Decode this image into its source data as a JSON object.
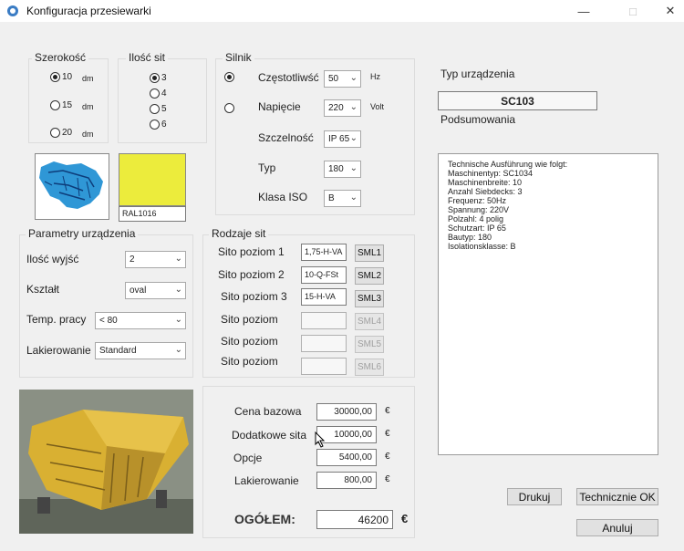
{
  "window": {
    "title": "Konfiguracja przesiewarki",
    "minimize_icon": "minimize-icon",
    "maximize_icon": "maximize-icon",
    "close_icon": "close-icon"
  },
  "szerokosc": {
    "label": "Szerokość",
    "options": [
      {
        "value": "10",
        "unit": "dm",
        "checked": true
      },
      {
        "value": "15",
        "unit": "dm",
        "checked": false
      },
      {
        "value": "20",
        "unit": "dm",
        "checked": false
      }
    ]
  },
  "ilosc_sit": {
    "label": "Ilość sit",
    "options": [
      {
        "value": "3",
        "checked": true
      },
      {
        "value": "4",
        "checked": false
      },
      {
        "value": "5",
        "checked": false
      },
      {
        "value": "6",
        "checked": false
      }
    ]
  },
  "silnik": {
    "label": "Silnik",
    "czestotliwosc_label": "Częstotliwść",
    "czestotliwosc_value": "50",
    "czestotliwosc_unit": "Hz",
    "napiecie_label": "Napięcie",
    "napiecie_value": "220",
    "napiecie_unit": "Volt",
    "szczelnosc_label": "Szczelność",
    "szczelnosc_value": "IP 65",
    "typ_label": "Typ",
    "typ_value": "180",
    "klasa_label": "Klasa ISO",
    "klasa_value": "B"
  },
  "color": {
    "swatch": "#ecec3c",
    "code": "RAL1016"
  },
  "typ_urzadzenia": {
    "label": "Typ urządzenia",
    "value": "SC103",
    "summary_label": "Podsumowania"
  },
  "summary_lines": [
    "Technische Ausführung wie folgt:",
    "Maschinentyp:   SC1034",
    "Maschinenbreite:   10",
    "Anzahl Siebdecks:   3",
    "Frequenz:   50Hz",
    "Spannung:   220V",
    "Polzahl:   4 polig",
    "Schutzart:   IP 65",
    "Bautyp:   180",
    "Isolationsklasse:   B"
  ],
  "parametry": {
    "label": "Parametry urządzenia",
    "wyjscia_label": "Ilość wyjść",
    "wyjscia_value": "2",
    "ksztalt_label": "Kształt",
    "ksztalt_value": "oval",
    "temp_label": "Temp. pracy",
    "temp_value": "< 80",
    "lakier_label": "Lakierowanie",
    "lakier_value": "Standard"
  },
  "rodzaje_sit": {
    "label": "Rodzaje sit",
    "rows": [
      {
        "label": "Sito poziom 1",
        "value": "1,75-H-VA",
        "button": "SML1",
        "enabled": true
      },
      {
        "label": "Sito poziom 2",
        "value": "10-Q-FSt",
        "button": "SML2",
        "enabled": true
      },
      {
        "label": "Sito poziom 3",
        "value": "15-H-VA",
        "button": "SML3",
        "enabled": true
      },
      {
        "label": "Sito poziom",
        "value": "",
        "button": "SML4",
        "enabled": false
      },
      {
        "label": "Sito poziom",
        "value": "",
        "button": "SML5",
        "enabled": false
      },
      {
        "label": "Sito poziom",
        "value": "",
        "button": "SML6",
        "enabled": false
      }
    ]
  },
  "ceny": {
    "bazowa_label": "Cena bazowa",
    "bazowa_value": "30000,00",
    "sita_label": "Dodatkowe sita",
    "sita_value": "10000,00",
    "opcje_label": "Opcje",
    "opcje_value": "5400,00",
    "lakier_label": "Lakierowanie",
    "lakier_value": "800,00",
    "total_label": "OGÓŁEM:",
    "total_value": "46200",
    "currency": "€"
  },
  "buttons": {
    "drukuj": "Drukuj",
    "technicznie": "Technicznie OK",
    "anuluj": "Anuluj"
  }
}
